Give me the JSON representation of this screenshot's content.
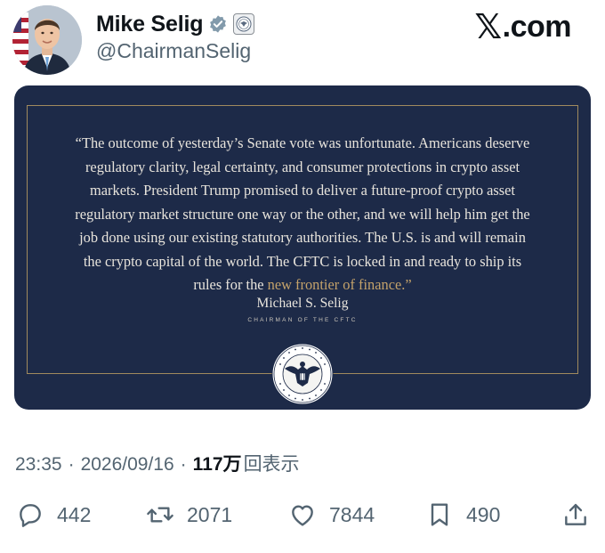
{
  "header": {
    "name": "Mike Selig",
    "handle": "@ChairmanSelig",
    "site_logo_text": ".com",
    "avatar_icon": "profile-photo",
    "verified_icon": "verified-badge-icon",
    "affiliation_icon": "government-seal-icon"
  },
  "media": {
    "quote_lead": "“The outcome of yesterday’s Senate vote was unfortunate. Americans deserve regulatory clarity, legal certainty, and consumer protections in crypto asset markets. President Trump promised to deliver a future-proof crypto asset regulatory market structure one way or the other, and we will help him get the job done using our existing statutory authorities. The U.S. is and will remain the crypto capital of the world. The CFTC is locked in and ready to ship its rules for the ",
    "quote_highlight": "new frontier of finance.”",
    "signature_name": "Michael S. Selig",
    "signature_title": "CHAIRMAN OF THE CFTC",
    "seal_icon": "cftc-seal-icon",
    "colors": {
      "background": "#1d2a48",
      "accent_gold": "#c4a26a",
      "text": "#e8e4dc"
    }
  },
  "meta": {
    "time": "23:35",
    "separator": "·",
    "date": "2026/09/16",
    "views_count": "117万",
    "views_label": "回表示"
  },
  "actions": {
    "reply_count": "442",
    "repost_count": "2071",
    "like_count": "7844",
    "bookmark_count": "490"
  }
}
